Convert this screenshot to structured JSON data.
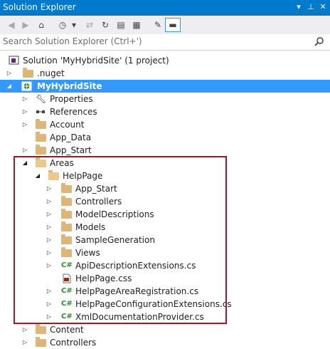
{
  "window": {
    "title": "Solution Explorer"
  },
  "toolbar": {
    "icons": [
      "back-icon",
      "forward-icon",
      "home-icon",
      "history-icon",
      "dropdown-icon",
      "sync-icon",
      "refresh-icon",
      "collapse-all-icon",
      "show-all-files-icon",
      "properties-icon",
      "preview-icon"
    ]
  },
  "search": {
    "placeholder": "Search Solution Explorer (Ctrl+')"
  },
  "tree": [
    {
      "label": "Solution 'MyHybridSite' (1 project)",
      "icon": "solution-icon"
    },
    {
      "label": ".nuget",
      "icon": "folder-icon"
    },
    {
      "label": "MyHybridSite",
      "icon": "web-project-icon"
    },
    {
      "label": "Properties",
      "icon": "wrench-icon"
    },
    {
      "label": "References",
      "icon": "references-icon"
    },
    {
      "label": "Account",
      "icon": "folder-icon"
    },
    {
      "label": "App_Data",
      "icon": "folder-icon"
    },
    {
      "label": "App_Start",
      "icon": "folder-icon"
    },
    {
      "label": "Areas",
      "icon": "folder-open-icon"
    },
    {
      "label": "HelpPage",
      "icon": "folder-open-icon"
    },
    {
      "label": "App_Start",
      "icon": "folder-icon"
    },
    {
      "label": "Controllers",
      "icon": "folder-icon"
    },
    {
      "label": "ModelDescriptions",
      "icon": "folder-icon"
    },
    {
      "label": "Models",
      "icon": "folder-icon"
    },
    {
      "label": "SampleGeneration",
      "icon": "folder-icon"
    },
    {
      "label": "Views",
      "icon": "folder-icon"
    },
    {
      "label": "ApiDescriptionExtensions.cs",
      "icon": "csharp-file-icon"
    },
    {
      "label": "HelpPage.css",
      "icon": "css-file-icon"
    },
    {
      "label": "HelpPageAreaRegistration.cs",
      "icon": "csharp-file-icon"
    },
    {
      "label": "HelpPageConfigurationExtensions.cs",
      "icon": "csharp-file-icon"
    },
    {
      "label": "XmlDocumentationProvider.cs",
      "icon": "csharp-file-icon"
    },
    {
      "label": "Content",
      "icon": "folder-icon"
    },
    {
      "label": "Controllers",
      "icon": "folder-icon"
    }
  ],
  "colors": {
    "accent": "#007acc",
    "selection": "#3399ff",
    "highlight_box": "#a01820",
    "folder": "#dcb67a",
    "csharp": "#368832"
  }
}
